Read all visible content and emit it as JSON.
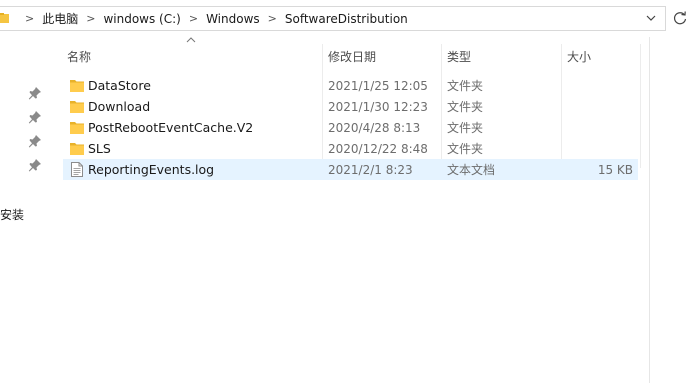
{
  "address": {
    "crumbs": [
      "此电脑",
      "windows (C:)",
      "Windows",
      "SoftwareDistribution"
    ]
  },
  "left_pane": {
    "label": "安装"
  },
  "columns": {
    "name": "名称",
    "date": "修改日期",
    "type": "类型",
    "size": "大小"
  },
  "files": [
    {
      "name": "DataStore",
      "date": "2021/1/25 12:05",
      "type": "文件夹",
      "size": "",
      "icon": "folder-icon"
    },
    {
      "name": "Download",
      "date": "2021/1/30 12:23",
      "type": "文件夹",
      "size": "",
      "icon": "folder-icon"
    },
    {
      "name": "PostRebootEventCache.V2",
      "date": "2020/4/28 8:13",
      "type": "文件夹",
      "size": "",
      "icon": "folder-icon"
    },
    {
      "name": "SLS",
      "date": "2020/12/22 8:48",
      "type": "文件夹",
      "size": "",
      "icon": "folder-icon"
    },
    {
      "name": "ReportingEvents.log",
      "date": "2021/2/1 8:23",
      "type": "文本文档",
      "size": "15 KB",
      "icon": "text-file-icon",
      "selected": true
    }
  ],
  "colors": {
    "folder": "#ffcc4d",
    "selected_row": "#e5f3ff"
  }
}
